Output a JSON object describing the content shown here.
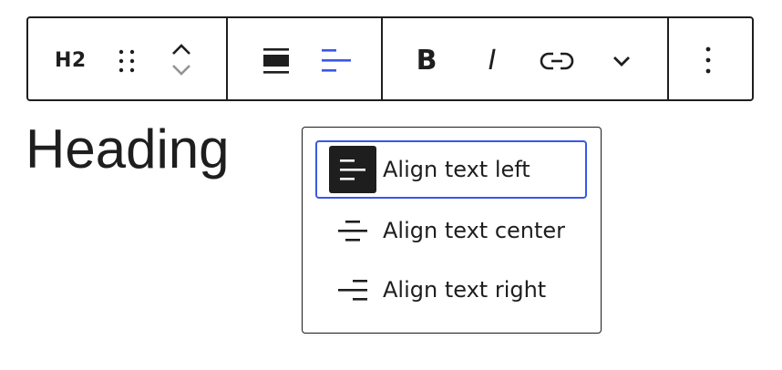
{
  "toolbar": {
    "block_type_label": "H2",
    "bold_label": "B",
    "italic_label": "I"
  },
  "content": {
    "heading": "Heading"
  },
  "align_menu": {
    "items": [
      {
        "label": "Align text left",
        "icon": "align-left-icon",
        "selected": true
      },
      {
        "label": "Align text center",
        "icon": "align-center-icon",
        "selected": false
      },
      {
        "label": "Align text right",
        "icon": "align-right-icon",
        "selected": false
      }
    ]
  },
  "colors": {
    "text": "#1e1e1e",
    "accent": "#3858e9",
    "disabled": "#949494"
  }
}
